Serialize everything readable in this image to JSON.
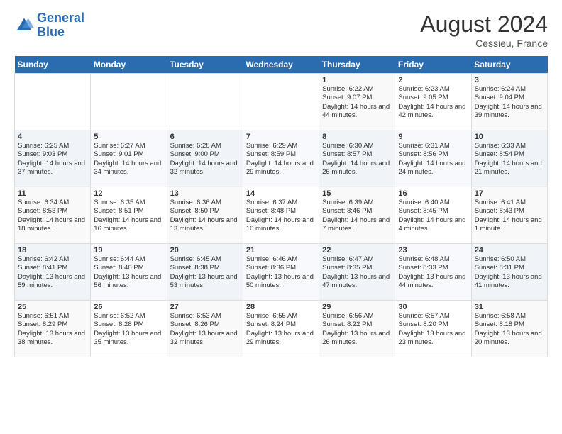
{
  "header": {
    "logo_line1": "General",
    "logo_line2": "Blue",
    "month_year": "August 2024",
    "location": "Cessieu, France"
  },
  "days_of_week": [
    "Sunday",
    "Monday",
    "Tuesday",
    "Wednesday",
    "Thursday",
    "Friday",
    "Saturday"
  ],
  "weeks": [
    [
      {
        "day": "",
        "info": ""
      },
      {
        "day": "",
        "info": ""
      },
      {
        "day": "",
        "info": ""
      },
      {
        "day": "",
        "info": ""
      },
      {
        "day": "1",
        "info": "Sunrise: 6:22 AM\nSunset: 9:07 PM\nDaylight: 14 hours and 44 minutes."
      },
      {
        "day": "2",
        "info": "Sunrise: 6:23 AM\nSunset: 9:05 PM\nDaylight: 14 hours and 42 minutes."
      },
      {
        "day": "3",
        "info": "Sunrise: 6:24 AM\nSunset: 9:04 PM\nDaylight: 14 hours and 39 minutes."
      }
    ],
    [
      {
        "day": "4",
        "info": "Sunrise: 6:25 AM\nSunset: 9:03 PM\nDaylight: 14 hours and 37 minutes."
      },
      {
        "day": "5",
        "info": "Sunrise: 6:27 AM\nSunset: 9:01 PM\nDaylight: 14 hours and 34 minutes."
      },
      {
        "day": "6",
        "info": "Sunrise: 6:28 AM\nSunset: 9:00 PM\nDaylight: 14 hours and 32 minutes."
      },
      {
        "day": "7",
        "info": "Sunrise: 6:29 AM\nSunset: 8:59 PM\nDaylight: 14 hours and 29 minutes."
      },
      {
        "day": "8",
        "info": "Sunrise: 6:30 AM\nSunset: 8:57 PM\nDaylight: 14 hours and 26 minutes."
      },
      {
        "day": "9",
        "info": "Sunrise: 6:31 AM\nSunset: 8:56 PM\nDaylight: 14 hours and 24 minutes."
      },
      {
        "day": "10",
        "info": "Sunrise: 6:33 AM\nSunset: 8:54 PM\nDaylight: 14 hours and 21 minutes."
      }
    ],
    [
      {
        "day": "11",
        "info": "Sunrise: 6:34 AM\nSunset: 8:53 PM\nDaylight: 14 hours and 18 minutes."
      },
      {
        "day": "12",
        "info": "Sunrise: 6:35 AM\nSunset: 8:51 PM\nDaylight: 14 hours and 16 minutes."
      },
      {
        "day": "13",
        "info": "Sunrise: 6:36 AM\nSunset: 8:50 PM\nDaylight: 14 hours and 13 minutes."
      },
      {
        "day": "14",
        "info": "Sunrise: 6:37 AM\nSunset: 8:48 PM\nDaylight: 14 hours and 10 minutes."
      },
      {
        "day": "15",
        "info": "Sunrise: 6:39 AM\nSunset: 8:46 PM\nDaylight: 14 hours and 7 minutes."
      },
      {
        "day": "16",
        "info": "Sunrise: 6:40 AM\nSunset: 8:45 PM\nDaylight: 14 hours and 4 minutes."
      },
      {
        "day": "17",
        "info": "Sunrise: 6:41 AM\nSunset: 8:43 PM\nDaylight: 14 hours and 1 minute."
      }
    ],
    [
      {
        "day": "18",
        "info": "Sunrise: 6:42 AM\nSunset: 8:41 PM\nDaylight: 13 hours and 59 minutes."
      },
      {
        "day": "19",
        "info": "Sunrise: 6:44 AM\nSunset: 8:40 PM\nDaylight: 13 hours and 56 minutes."
      },
      {
        "day": "20",
        "info": "Sunrise: 6:45 AM\nSunset: 8:38 PM\nDaylight: 13 hours and 53 minutes."
      },
      {
        "day": "21",
        "info": "Sunrise: 6:46 AM\nSunset: 8:36 PM\nDaylight: 13 hours and 50 minutes."
      },
      {
        "day": "22",
        "info": "Sunrise: 6:47 AM\nSunset: 8:35 PM\nDaylight: 13 hours and 47 minutes."
      },
      {
        "day": "23",
        "info": "Sunrise: 6:48 AM\nSunset: 8:33 PM\nDaylight: 13 hours and 44 minutes."
      },
      {
        "day": "24",
        "info": "Sunrise: 6:50 AM\nSunset: 8:31 PM\nDaylight: 13 hours and 41 minutes."
      }
    ],
    [
      {
        "day": "25",
        "info": "Sunrise: 6:51 AM\nSunset: 8:29 PM\nDaylight: 13 hours and 38 minutes."
      },
      {
        "day": "26",
        "info": "Sunrise: 6:52 AM\nSunset: 8:28 PM\nDaylight: 13 hours and 35 minutes."
      },
      {
        "day": "27",
        "info": "Sunrise: 6:53 AM\nSunset: 8:26 PM\nDaylight: 13 hours and 32 minutes."
      },
      {
        "day": "28",
        "info": "Sunrise: 6:55 AM\nSunset: 8:24 PM\nDaylight: 13 hours and 29 minutes."
      },
      {
        "day": "29",
        "info": "Sunrise: 6:56 AM\nSunset: 8:22 PM\nDaylight: 13 hours and 26 minutes."
      },
      {
        "day": "30",
        "info": "Sunrise: 6:57 AM\nSunset: 8:20 PM\nDaylight: 13 hours and 23 minutes."
      },
      {
        "day": "31",
        "info": "Sunrise: 6:58 AM\nSunset: 8:18 PM\nDaylight: 13 hours and 20 minutes."
      }
    ]
  ]
}
